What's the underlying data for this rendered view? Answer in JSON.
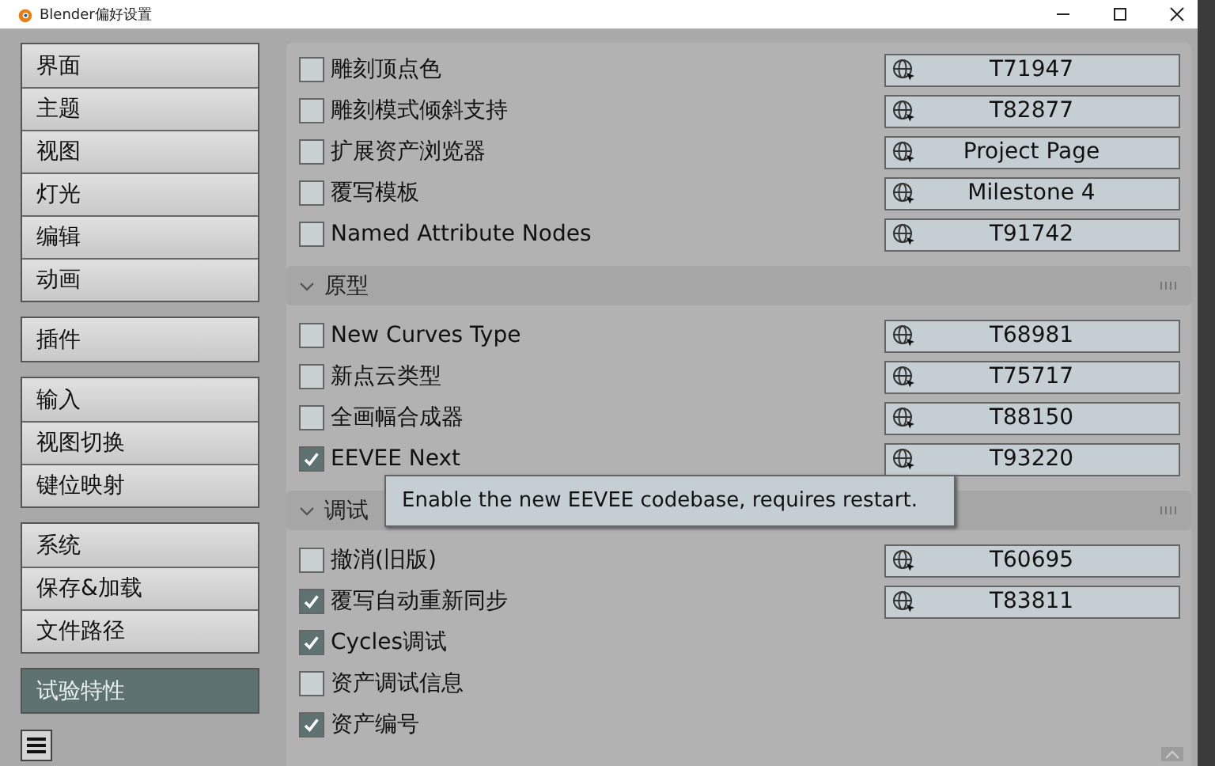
{
  "window": {
    "title": "Blender偏好设置"
  },
  "sidebar": {
    "groups": [
      {
        "items": [
          {
            "label": "界面",
            "selected": false
          },
          {
            "label": "主题",
            "selected": false
          },
          {
            "label": "视图",
            "selected": false
          },
          {
            "label": "灯光",
            "selected": false
          },
          {
            "label": "编辑",
            "selected": false
          },
          {
            "label": "动画",
            "selected": false
          }
        ]
      },
      {
        "items": [
          {
            "label": "插件",
            "selected": false
          }
        ]
      },
      {
        "items": [
          {
            "label": "输入",
            "selected": false
          },
          {
            "label": "视图切换",
            "selected": false
          },
          {
            "label": "键位映射",
            "selected": false
          }
        ]
      },
      {
        "items": [
          {
            "label": "系统",
            "selected": false
          },
          {
            "label": "保存&加载",
            "selected": false
          },
          {
            "label": "文件路径",
            "selected": false
          }
        ]
      },
      {
        "items": [
          {
            "label": "试验特性",
            "selected": true
          }
        ]
      }
    ]
  },
  "content": {
    "sections": [
      {
        "rows": [
          {
            "label": "雕刻顶点色",
            "checked": false,
            "link": "T71947"
          },
          {
            "label": "雕刻模式倾斜支持",
            "checked": false,
            "link": "T82877"
          },
          {
            "label": "扩展资产浏览器",
            "checked": false,
            "link": "Project Page"
          },
          {
            "label": "覆写模板",
            "checked": false,
            "link": "Milestone 4"
          },
          {
            "label": "Named Attribute Nodes",
            "checked": false,
            "link": "T91742"
          }
        ]
      },
      {
        "title": "原型",
        "expanded": true,
        "rows": [
          {
            "label": "New Curves Type",
            "checked": false,
            "link": "T68981"
          },
          {
            "label": "新点云类型",
            "checked": false,
            "link": "T75717"
          },
          {
            "label": "全画幅合成器",
            "checked": false,
            "link": "T88150"
          },
          {
            "label": "EEVEE Next",
            "checked": true,
            "link": "T93220"
          }
        ]
      },
      {
        "title": "调试",
        "expanded": true,
        "rows": [
          {
            "label": "撤消(旧版)",
            "checked": false,
            "link": "T60695"
          },
          {
            "label": "覆写自动重新同步",
            "checked": true,
            "link": "T83811"
          },
          {
            "label": "Cycles调试",
            "checked": true
          },
          {
            "label": "资产调试信息",
            "checked": false
          },
          {
            "label": "资产编号",
            "checked": true
          }
        ]
      }
    ]
  },
  "tooltip": {
    "text": "Enable the new EEVEE codebase, requires restart."
  }
}
